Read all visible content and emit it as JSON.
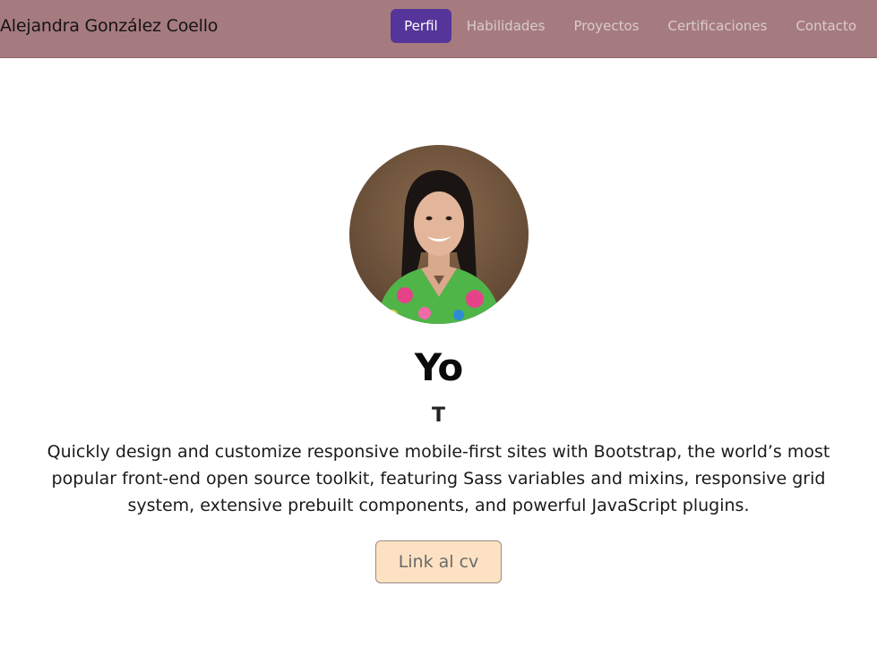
{
  "brand": {
    "name": "Alejandra González Coello"
  },
  "nav": {
    "items": [
      {
        "label": "Perfil",
        "active": true
      },
      {
        "label": "Habilidades",
        "active": false
      },
      {
        "label": "Proyectos",
        "active": false
      },
      {
        "label": "Certificaciones",
        "active": false
      },
      {
        "label": "Contacto",
        "active": false
      }
    ]
  },
  "hero": {
    "avatar_icon": "profile-photo",
    "title": "Yo",
    "subtitle": "T",
    "lead": "Quickly design and customize responsive mobile-first sites with Bootstrap, the world’s most popular front-end open source toolkit, featuring Sass variables and mixins, responsive grid system, extensive prebuilt components, and powerful JavaScript plugins.",
    "cv_button": "Link al cv"
  },
  "colors": {
    "navbar_bg": "#a67b7f",
    "nav_active_bg": "#55359a",
    "nav_inactive_text": "#d9cbcc",
    "cv_button_bg": "#fce2c2"
  }
}
